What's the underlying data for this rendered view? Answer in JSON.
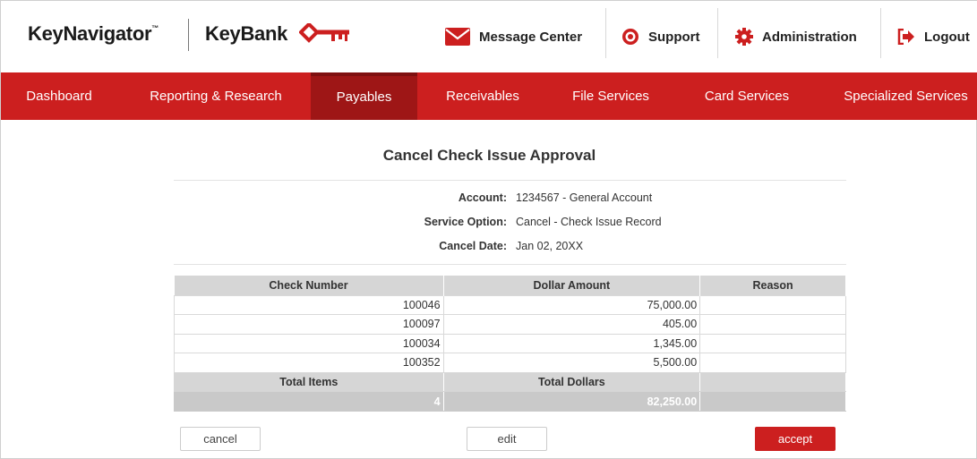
{
  "header": {
    "brand_primary": "KeyNavigator",
    "brand_tm": "™",
    "brand_secondary": "KeyBank",
    "util": {
      "message_center": "Message Center",
      "support": "Support",
      "administration": "Administration",
      "logout": "Logout"
    }
  },
  "nav": {
    "items": [
      "Dashboard",
      "Reporting & Research",
      "Payables",
      "Receivables",
      "File Services",
      "Card Services",
      "Specialized Services"
    ],
    "active": "Payables"
  },
  "page": {
    "title": "Cancel Check Issue Approval",
    "account_label": "Account:",
    "account_value": "1234567 - General Account",
    "service_label": "Service Option:",
    "service_value": "Cancel - Check Issue Record",
    "date_label": "Cancel Date:",
    "date_value": "Jan 02, 20XX"
  },
  "table": {
    "headers": [
      "Check Number",
      "Dollar Amount",
      "Reason"
    ],
    "rows": [
      [
        "100046",
        "75,000.00",
        ""
      ],
      [
        "100097",
        "405.00",
        ""
      ],
      [
        "100034",
        "1,345.00",
        ""
      ],
      [
        "100352",
        "5,500.00",
        ""
      ]
    ],
    "total_items_label": "Total Items",
    "total_dollars_label": "Total Dollars",
    "total_items_value": "4",
    "total_dollars_value": "82,250.00"
  },
  "buttons": {
    "cancel": "cancel",
    "edit": "edit",
    "accept": "accept"
  },
  "colors": {
    "brand_red": "#cc1f1f",
    "nav_active": "#9e1616"
  }
}
